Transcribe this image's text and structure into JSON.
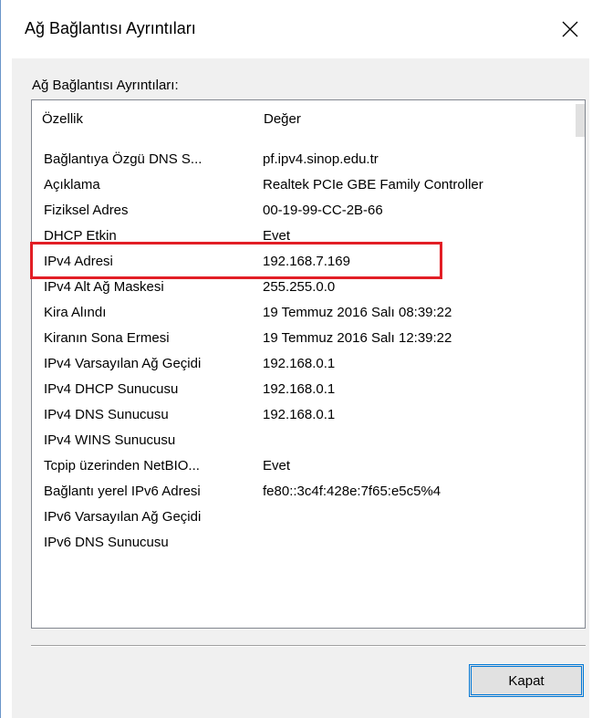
{
  "window": {
    "title": "Ağ Bağlantısı Ayrıntıları",
    "close_glyph": "✕"
  },
  "group_label": "Ağ Bağlantısı Ayrıntıları:",
  "table": {
    "columns": [
      "Özellik",
      "Değer"
    ],
    "rows": [
      {
        "property": "Bağlantıya Özgü DNS S...",
        "value": "pf.ipv4.sinop.edu.tr"
      },
      {
        "property": "Açıklama",
        "value": "Realtek PCIe GBE Family Controller"
      },
      {
        "property": "Fiziksel Adres",
        "value": "00-19-99-CC-2B-66"
      },
      {
        "property": "DHCP Etkin",
        "value": "Evet"
      },
      {
        "property": "IPv4 Adresi",
        "value": "192.168.7.169"
      },
      {
        "property": "IPv4 Alt Ağ Maskesi",
        "value": "255.255.0.0"
      },
      {
        "property": "Kira Alındı",
        "value": "19 Temmuz 2016 Salı 08:39:22"
      },
      {
        "property": "Kiranın Sona Ermesi",
        "value": "19 Temmuz 2016 Salı 12:39:22"
      },
      {
        "property": "IPv4 Varsayılan Ağ Geçidi",
        "value": "192.168.0.1"
      },
      {
        "property": "IPv4 DHCP Sunucusu",
        "value": "192.168.0.1"
      },
      {
        "property": "IPv4 DNS Sunucusu",
        "value": "192.168.0.1"
      },
      {
        "property": "IPv4 WINS Sunucusu",
        "value": ""
      },
      {
        "property": "Tcpip üzerinden NetBIO...",
        "value": "Evet"
      },
      {
        "property": "Bağlantı yerel IPv6 Adresi",
        "value": "fe80::3c4f:428e:7f65:e5c5%4"
      },
      {
        "property": "IPv6 Varsayılan Ağ Geçidi",
        "value": ""
      },
      {
        "property": "IPv6 DNS Sunucusu",
        "value": ""
      }
    ]
  },
  "buttons": {
    "close_label": "Kapat"
  },
  "colors": {
    "highlight": "#e21e25",
    "accent": "#0078d7"
  }
}
